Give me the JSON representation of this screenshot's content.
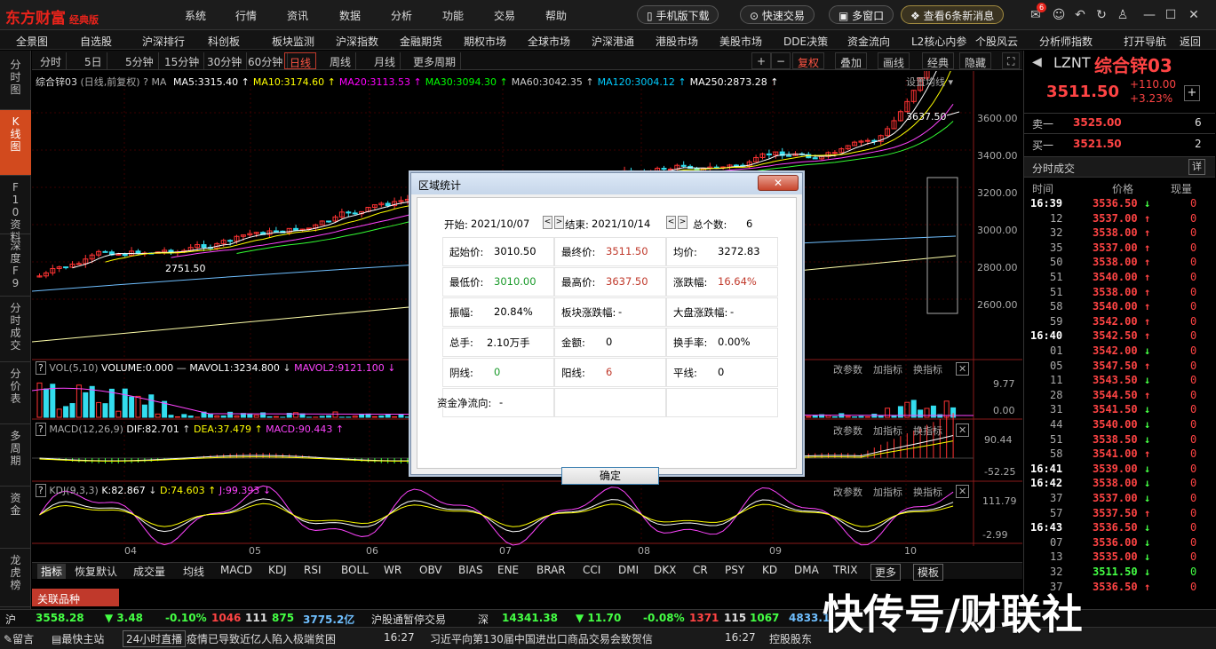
{
  "app": {
    "logo": "东方财富",
    "edition": "经典版"
  },
  "top_menu": [
    "系统",
    "行情",
    "资讯",
    "数据",
    "分析",
    "功能",
    "交易",
    "帮助"
  ],
  "top_actions": {
    "mobile": "手机版下载",
    "quick_trade": "快速交易",
    "multi_window": "多窗口",
    "news": "查看6条新消息",
    "badge": "6"
  },
  "nav": [
    "全景图",
    "自选股",
    "沪深排行",
    "科创板",
    "板块监测",
    "沪深指数",
    "金融期货",
    "期权市场",
    "全球市场",
    "沪深港通",
    "港股市场",
    "美股市场",
    "DDE决策",
    "资金流向",
    "L2核心内参",
    "个股风云",
    "分析师指数",
    "打开导航",
    "返回"
  ],
  "sidebar": [
    "分时图",
    "K线图",
    "F10资料",
    "深度F9",
    "分时成交",
    "分价表",
    "多周期",
    "资金",
    "龙虎榜"
  ],
  "periods": [
    "分时",
    "5日",
    "5分钟",
    "15分钟",
    "30分钟",
    "60分钟",
    "日线",
    "周线",
    "月线",
    "更多周期"
  ],
  "toolbar": [
    "+",
    "−",
    "复权",
    "叠加",
    "画线",
    "经典",
    "隐藏"
  ],
  "chart": {
    "title": "综合锌03",
    "mode": "(日线,前复权)",
    "ma_prefix": "MA",
    "ma": [
      {
        "label": "MA5:3315.40",
        "color": "#ffffff"
      },
      {
        "label": "MA10:3174.60",
        "color": "#ffff00"
      },
      {
        "label": "MA20:3113.53",
        "color": "#ff00ff"
      },
      {
        "label": "MA30:3094.30",
        "color": "#00ff00"
      },
      {
        "label": "MA60:3042.35",
        "color": "#cccccc"
      },
      {
        "label": "MA120:3004.12",
        "color": "#00ccff"
      },
      {
        "label": "MA250:2873.28",
        "color": "#ffffff"
      }
    ],
    "settings": "设置均线",
    "high_marker": "3637.50",
    "low_marker": "2751.50",
    "price_ticks": [
      "3600.00",
      "3400.00",
      "3200.00",
      "3000.00",
      "2800.00",
      "2600.00"
    ],
    "vol": {
      "label": "VOL(5,10)",
      "v1": "VOLUME:0.000",
      "v2": "MAVOL1:3234.800",
      "v3": "MAVOL2:9121.100",
      "ticks": [
        "9.77",
        "0.00"
      ]
    },
    "macd": {
      "label": "MACD(12,26,9)",
      "v1": "DIF:82.701",
      "v2": "DEA:37.479",
      "v3": "MACD:90.443",
      "ticks": [
        "90.44",
        "-52.25"
      ]
    },
    "kdj": {
      "label": "KDJ(9,3,3)",
      "v1": "K:82.867",
      "v2": "D:74.603",
      "v3": "J:99.393",
      "ticks": [
        "111.79",
        "-2.99"
      ]
    },
    "panel_actions": [
      "改参数",
      "加指标",
      "换指标"
    ],
    "months": [
      "04",
      "05",
      "06",
      "07",
      "08",
      "09",
      "10"
    ]
  },
  "indicators": [
    "指标",
    "恢复默认",
    "成交量",
    "均线",
    "MACD",
    "KDJ",
    "RSI",
    "BOLL",
    "WR",
    "OBV",
    "BIAS",
    "ENE",
    "BRAR",
    "CCI",
    "DMI",
    "DKX",
    "CR",
    "PSY",
    "KD",
    "DMA",
    "TRIX",
    "更多",
    "模板"
  ],
  "related": "关联品种",
  "quote": {
    "code": "LZNT",
    "name": "综合锌03",
    "price": "3511.50",
    "change": "+110.00",
    "pct": "+3.23%",
    "sell_label": "卖一",
    "sell_price": "3525.00",
    "sell_vol": "6",
    "buy_label": "买一",
    "buy_price": "3521.50",
    "buy_vol": "2",
    "ticks_title": "分时成交",
    "ticks_btn": "详",
    "col_time": "时间",
    "col_price": "价格",
    "col_vol": "现量"
  },
  "ticks": [
    {
      "t": "16:39",
      "p": "3536.50",
      "d": "↓",
      "v": "0"
    },
    {
      "t": "12",
      "p": "3537.00",
      "d": "↑",
      "v": "0"
    },
    {
      "t": "32",
      "p": "3538.00",
      "d": "↑",
      "v": "0"
    },
    {
      "t": "35",
      "p": "3537.00",
      "d": "↑",
      "v": "0"
    },
    {
      "t": "50",
      "p": "3538.00",
      "d": "↑",
      "v": "0"
    },
    {
      "t": "51",
      "p": "3540.00",
      "d": "↑",
      "v": "0"
    },
    {
      "t": "51",
      "p": "3538.00",
      "d": "↑",
      "v": "0"
    },
    {
      "t": "58",
      "p": "3540.00",
      "d": "↑",
      "v": "0"
    },
    {
      "t": "59",
      "p": "3542.00",
      "d": "↑",
      "v": "0"
    },
    {
      "t": "16:40",
      "p": "3542.50",
      "d": "↑",
      "v": "0"
    },
    {
      "t": "01",
      "p": "3542.00",
      "d": "↓",
      "v": "0"
    },
    {
      "t": "05",
      "p": "3547.50",
      "d": "↑",
      "v": "0"
    },
    {
      "t": "11",
      "p": "3543.50",
      "d": "↓",
      "v": "0"
    },
    {
      "t": "28",
      "p": "3544.50",
      "d": "↑",
      "v": "0"
    },
    {
      "t": "31",
      "p": "3541.50",
      "d": "↓",
      "v": "0"
    },
    {
      "t": "44",
      "p": "3540.00",
      "d": "↓",
      "v": "0"
    },
    {
      "t": "51",
      "p": "3538.50",
      "d": "↓",
      "v": "0"
    },
    {
      "t": "58",
      "p": "3541.00",
      "d": "↑",
      "v": "0"
    },
    {
      "t": "16:41",
      "p": "3539.00",
      "d": "↓",
      "v": "0"
    },
    {
      "t": "16:42",
      "p": "3538.00",
      "d": "↓",
      "v": "0"
    },
    {
      "t": "37",
      "p": "3537.00",
      "d": "↓",
      "v": "0"
    },
    {
      "t": "57",
      "p": "3537.50",
      "d": "↑",
      "v": "0"
    },
    {
      "t": "16:43",
      "p": "3536.50",
      "d": "↓",
      "v": "0"
    },
    {
      "t": "07",
      "p": "3536.00",
      "d": "↓",
      "v": "0"
    },
    {
      "t": "13",
      "p": "3535.00",
      "d": "↓",
      "v": "0"
    },
    {
      "t": "32",
      "p": "3511.50",
      "d": "↓",
      "v": "0"
    },
    {
      "t": "37",
      "p": "3536.50",
      "d": "↑",
      "v": "0"
    }
  ],
  "status": {
    "sh_label": "沪",
    "sh_index": "3558.28",
    "sh_chg": "▼ 3.48",
    "sh_pct": "-0.10%",
    "sh_n1": "1046",
    "sh_n2": "111",
    "sh_n3": "875",
    "sh_amt": "3775.2亿",
    "hk_text": "沪股通暂停交易",
    "sz_label": "深",
    "sz_index": "14341.38",
    "sz_chg": "▼ 11.70",
    "sz_pct": "-0.08%",
    "sz_n1": "1371",
    "sz_n2": "115",
    "sz_n3": "1067",
    "sz_amt": "4833.1"
  },
  "bottom": {
    "msg": "留言",
    "quick": "最快主站",
    "live": "24小时直播",
    "news1": "疫情已导致近亿人陷入极端贫困",
    "time1": "16:27",
    "news2": "习近平向第130届中国进出口商品交易会致贺信",
    "time2": "16:27",
    "news3": "控股股东"
  },
  "dialog": {
    "title": "区域统计",
    "close": "✕",
    "start_label": "开始:",
    "start": "2021/10/07",
    "end_label": "结束:",
    "end": "2021/10/14",
    "count_label": "总个数:",
    "count": "6",
    "rows": [
      [
        {
          "l": "起始价:",
          "v": "3010.50",
          "c": "#000"
        },
        {
          "l": "最终价:",
          "v": "3511.50",
          "c": "#c0392b"
        },
        {
          "l": "均价:",
          "v": "3272.83",
          "c": "#000"
        }
      ],
      [
        {
          "l": "最低价:",
          "v": "3010.00",
          "c": "#1a9a2a"
        },
        {
          "l": "最高价:",
          "v": "3637.50",
          "c": "#c0392b"
        },
        {
          "l": "涨跌幅:",
          "v": "16.64%",
          "c": "#c0392b"
        }
      ],
      [
        {
          "l": "振幅:",
          "v": "20.84%",
          "c": "#000"
        },
        {
          "l": "板块涨跌幅:",
          "v": "-",
          "c": "#000"
        },
        {
          "l": "大盘涨跌幅:",
          "v": "-",
          "c": "#000"
        }
      ],
      [
        {
          "l": "总手:",
          "v": "2.10万手",
          "c": "#000"
        },
        {
          "l": "金额:",
          "v": "0",
          "c": "#000"
        },
        {
          "l": "换手率:",
          "v": "0.00%",
          "c": "#000"
        }
      ],
      [
        {
          "l": "阴线:",
          "v": "0",
          "c": "#1a9a2a"
        },
        {
          "l": "阳线:",
          "v": "6",
          "c": "#c0392b"
        },
        {
          "l": "平线:",
          "v": "0",
          "c": "#000"
        }
      ],
      [
        {
          "l": "资金净流向:",
          "v": "-",
          "c": "#000"
        },
        {
          "l": "",
          "v": "",
          "c": "#000"
        },
        {
          "l": "",
          "v": "",
          "c": "#000"
        }
      ]
    ],
    "ok": "确定"
  },
  "watermark": "快传号/财联社"
}
